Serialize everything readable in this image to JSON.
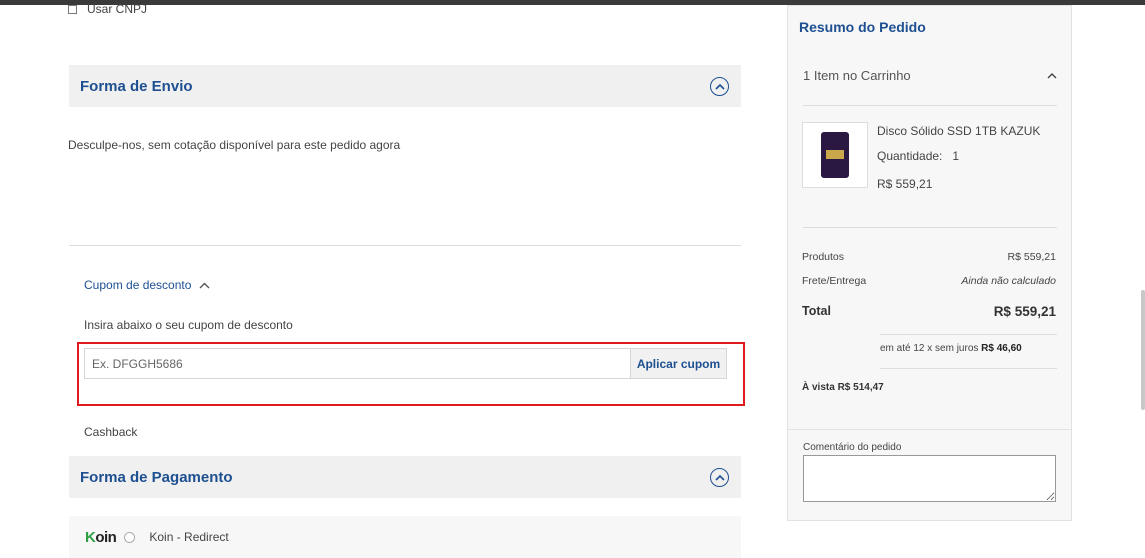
{
  "checkout": {
    "use_cnpj_label": "Usar CNPJ",
    "shipping": {
      "title": "Forma de Envio",
      "message": "Desculpe-nos, sem cotação disponível para este pedido agora"
    },
    "coupon": {
      "toggle_label": "Cupom de desconto",
      "hint": "Insira abaixo o seu cupom de desconto",
      "placeholder": "Ex. DFGGH5686",
      "apply_label": "Aplicar cupom"
    },
    "cashback_label": "Cashback",
    "payment": {
      "title": "Forma de Pagamento",
      "methods": [
        {
          "logo_text": "Koin",
          "label": "Koin - Redirect"
        }
      ]
    }
  },
  "summary": {
    "title": "Resumo do Pedido",
    "cart_count_label": "1 Item no Carrinho",
    "item": {
      "name": "Disco Sólido SSD 1TB KAZUK",
      "qty_label": "Quantidade:",
      "qty_value": "1",
      "price": "R$ 559,21"
    },
    "lines": {
      "products_label": "Produtos",
      "products_value": "R$ 559,21",
      "shipping_label": "Frete/Entrega",
      "shipping_value": "Ainda não calculado"
    },
    "total_label": "Total",
    "total_value": "R$ 559,21",
    "installments_text": "em até 12 x sem juros",
    "installments_value": "R$ 46,60",
    "cash_price": "À vista R$ 514,47",
    "comment_label": "Comentário do pedido"
  },
  "colors": {
    "accent": "#1d4f91",
    "highlight": "#e0191f",
    "koin_green": "#2ea043"
  }
}
